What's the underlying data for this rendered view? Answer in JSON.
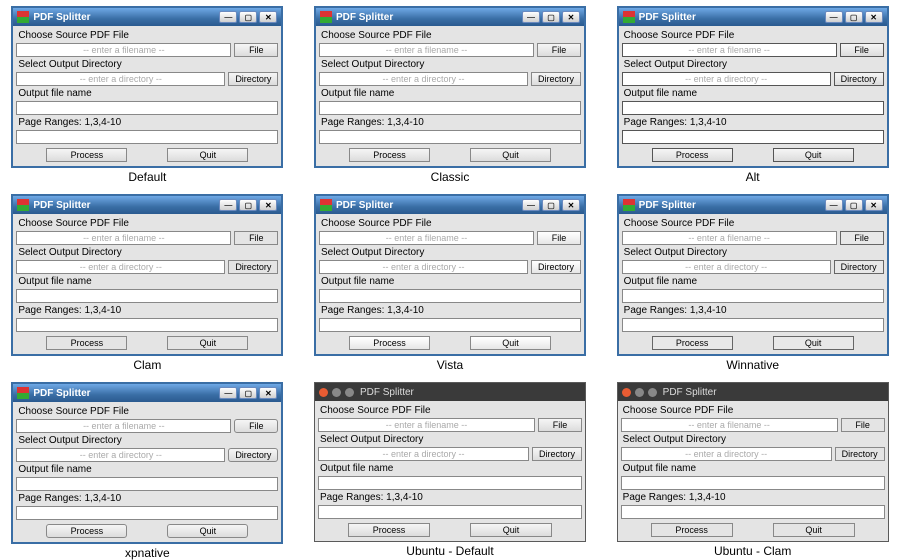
{
  "window_title": "PDF Splitter",
  "labels": {
    "source": "Choose Source PDF File",
    "outdir": "Select Output Directory",
    "outfile": "Output file name",
    "ranges": "Page Ranges: 1,3,4-10"
  },
  "placeholders": {
    "filename": "-- enter a filename --",
    "directory": "-- enter a directory --"
  },
  "buttons": {
    "file": "File",
    "directory": "Directory",
    "process": "Process",
    "quit": "Quit"
  },
  "captions": [
    "Default",
    "Classic",
    "Alt",
    "Clam",
    "Vista",
    "Winnative",
    "xpnative",
    "Ubuntu - Default",
    "Ubuntu - Clam"
  ],
  "variants": [
    {
      "os": "win",
      "theme": "default"
    },
    {
      "os": "win",
      "theme": "classic"
    },
    {
      "os": "win",
      "theme": "alt"
    },
    {
      "os": "win",
      "theme": "clam"
    },
    {
      "os": "win",
      "theme": "vista"
    },
    {
      "os": "win",
      "theme": "winnative"
    },
    {
      "os": "win",
      "theme": "xpnative"
    },
    {
      "os": "ubuntu",
      "theme": "default"
    },
    {
      "os": "ubuntu",
      "theme": "clam"
    }
  ]
}
